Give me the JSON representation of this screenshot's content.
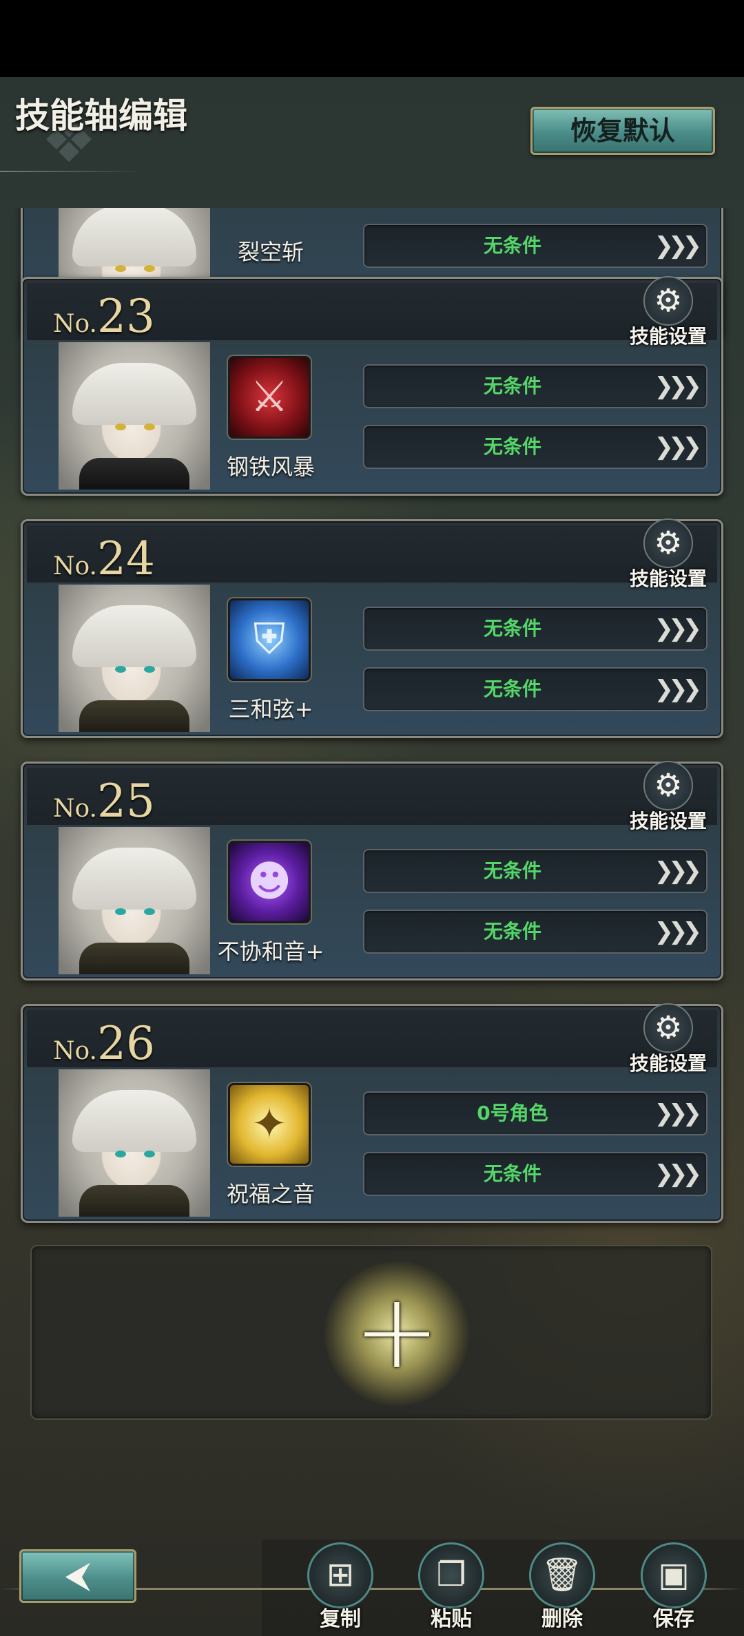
{
  "header": {
    "title": "技能轴编辑",
    "reset_label": "恢复默认"
  },
  "partial_card": {
    "skill_name": "裂空斩",
    "condition": "无条件"
  },
  "cards": [
    {
      "no_prefix": "No.",
      "number": "23",
      "settings_label": "技能设置",
      "skill_name": "钢铁风暴",
      "skill_icon": "sword-icon",
      "conditions": [
        "无条件",
        "无条件"
      ]
    },
    {
      "no_prefix": "No.",
      "number": "24",
      "settings_label": "技能设置",
      "skill_name": "三和弦+",
      "skill_icon": "shield-icon",
      "conditions": [
        "无条件",
        "无条件"
      ]
    },
    {
      "no_prefix": "No.",
      "number": "25",
      "settings_label": "技能设置",
      "skill_name": "不协和音+",
      "skill_icon": "dark-spirit-icon",
      "conditions": [
        "无条件",
        "无条件"
      ]
    },
    {
      "no_prefix": "No.",
      "number": "26",
      "settings_label": "技能设置",
      "skill_name": "祝福之音",
      "skill_icon": "blessing-icon",
      "conditions": [
        "0号角色",
        "无条件"
      ]
    }
  ],
  "toolbar": {
    "copy_label": "复制",
    "paste_label": "粘贴",
    "delete_label": "删除",
    "save_label": "保存"
  },
  "colors": {
    "condition_text": "#55d668",
    "number_gold": "#e7d6a1",
    "button_teal": "#4a8c88"
  }
}
